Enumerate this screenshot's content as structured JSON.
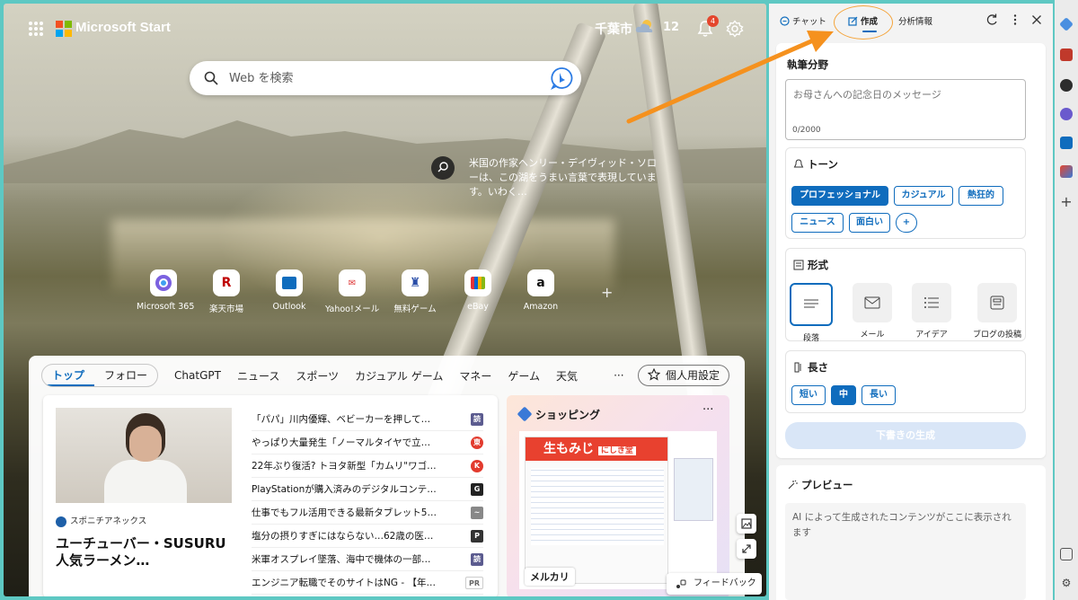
{
  "header": {
    "brand": "Microsoft Start",
    "city": "千葉市",
    "temperature": "12",
    "notification_count": "4"
  },
  "search": {
    "placeholder": "Web を検索"
  },
  "photo_caption": "米国の作家ヘンリー・デイヴィッド・ソローは、この湖をうまい言葉で表現しています。いわく…",
  "quick_links": [
    {
      "label": "Microsoft 365",
      "icon": "microsoft-365-icon"
    },
    {
      "label": "楽天市場",
      "icon": "rakuten-icon"
    },
    {
      "label": "Outlook",
      "icon": "outlook-icon"
    },
    {
      "label": "Yahoo!メール",
      "icon": "yahoo-mail-icon"
    },
    {
      "label": "無料ゲーム",
      "icon": "games-icon"
    },
    {
      "label": "eBay",
      "icon": "ebay-icon"
    },
    {
      "label": "Amazon",
      "icon": "amazon-icon"
    }
  ],
  "feed_nav": {
    "top": "トップ",
    "follow": "フォロー",
    "links": [
      "ChatGPT",
      "ニュース",
      "スポーツ",
      "カジュアル ゲーム",
      "マネー",
      "ゲーム",
      "天気"
    ],
    "more": "···",
    "personalize": "個人用設定"
  },
  "lead_story": {
    "source": "スポニチアネックス",
    "title": "ユーチューバー・SUSURU 人気ラーメン…"
  },
  "headlines": [
    {
      "text": "「パパ」川内優輝、ベビーカーを押して…",
      "badge": "読",
      "color": "#5b5b8f"
    },
    {
      "text": "やっぱり大量発生「ノーマルタイヤで立…",
      "badge": "東",
      "color": "#e23b2e"
    },
    {
      "text": "22年ぶり復活? トヨタ新型「カムリ\"ワゴ…",
      "badge": "K",
      "color": "#e23b2e"
    },
    {
      "text": "PlayStationが購入済みのデジタルコンテ…",
      "badge": "G",
      "color": "#222222"
    },
    {
      "text": "仕事でもフル活用できる最新タブレット5…",
      "badge": "~",
      "color": "#888888"
    },
    {
      "text": "塩分の摂りすぎにはならない…62歳の医…",
      "badge": "P",
      "color": "#333333"
    },
    {
      "text": "米軍オスプレイ墜落、海中で機体の一部…",
      "badge": "読",
      "color": "#5b5b8f"
    },
    {
      "text": "エンジニア転職でそのサイトはNG - 【年…",
      "badge": "PR",
      "color": "#666666"
    }
  ],
  "shopping": {
    "title": "ショッピング",
    "more": "···",
    "poster_text": "生もみじ",
    "store_tag": "にしき堂",
    "seller": "メルカリ"
  },
  "feedback": "フィードバック",
  "copilot": {
    "tabs": {
      "chat": "チャット",
      "compose": "作成",
      "insights": "分析情報"
    },
    "topic_heading": "執筆分野",
    "topic_placeholder": "お母さんへの記念日のメッセージ",
    "char_count": "0/2000",
    "tone_heading": "トーン",
    "tones": [
      "プロフェッショナル",
      "カジュアル",
      "熱狂的",
      "ニュース",
      "面白い",
      "+"
    ],
    "format_heading": "形式",
    "formats": [
      "段落",
      "メール",
      "アイデア",
      "ブログの投稿"
    ],
    "length_heading": "長さ",
    "lengths": [
      "短い",
      "中",
      "長い"
    ],
    "generate": "下書きの生成",
    "preview_heading": "プレビュー",
    "preview_text": "AI によって生成されたコンテンツがここに表示されます"
  },
  "colors": {
    "accent": "#0f6cbd",
    "annotation_arrow": "#f5911e"
  }
}
